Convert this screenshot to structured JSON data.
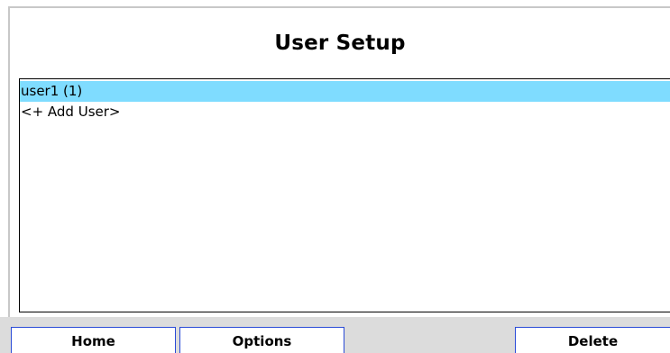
{
  "title": "User Setup",
  "users": {
    "items": [
      {
        "label": "user1 (1)",
        "selected": true
      },
      {
        "label": "<+ Add User>",
        "selected": false
      }
    ]
  },
  "toolbar": {
    "home_label": "Home",
    "options_label": "Options",
    "delete_label": "Delete"
  },
  "colors": {
    "selection": "#7fdcff",
    "button_border": "#2a4bd7",
    "bottom_bar": "#dcdcdc"
  }
}
